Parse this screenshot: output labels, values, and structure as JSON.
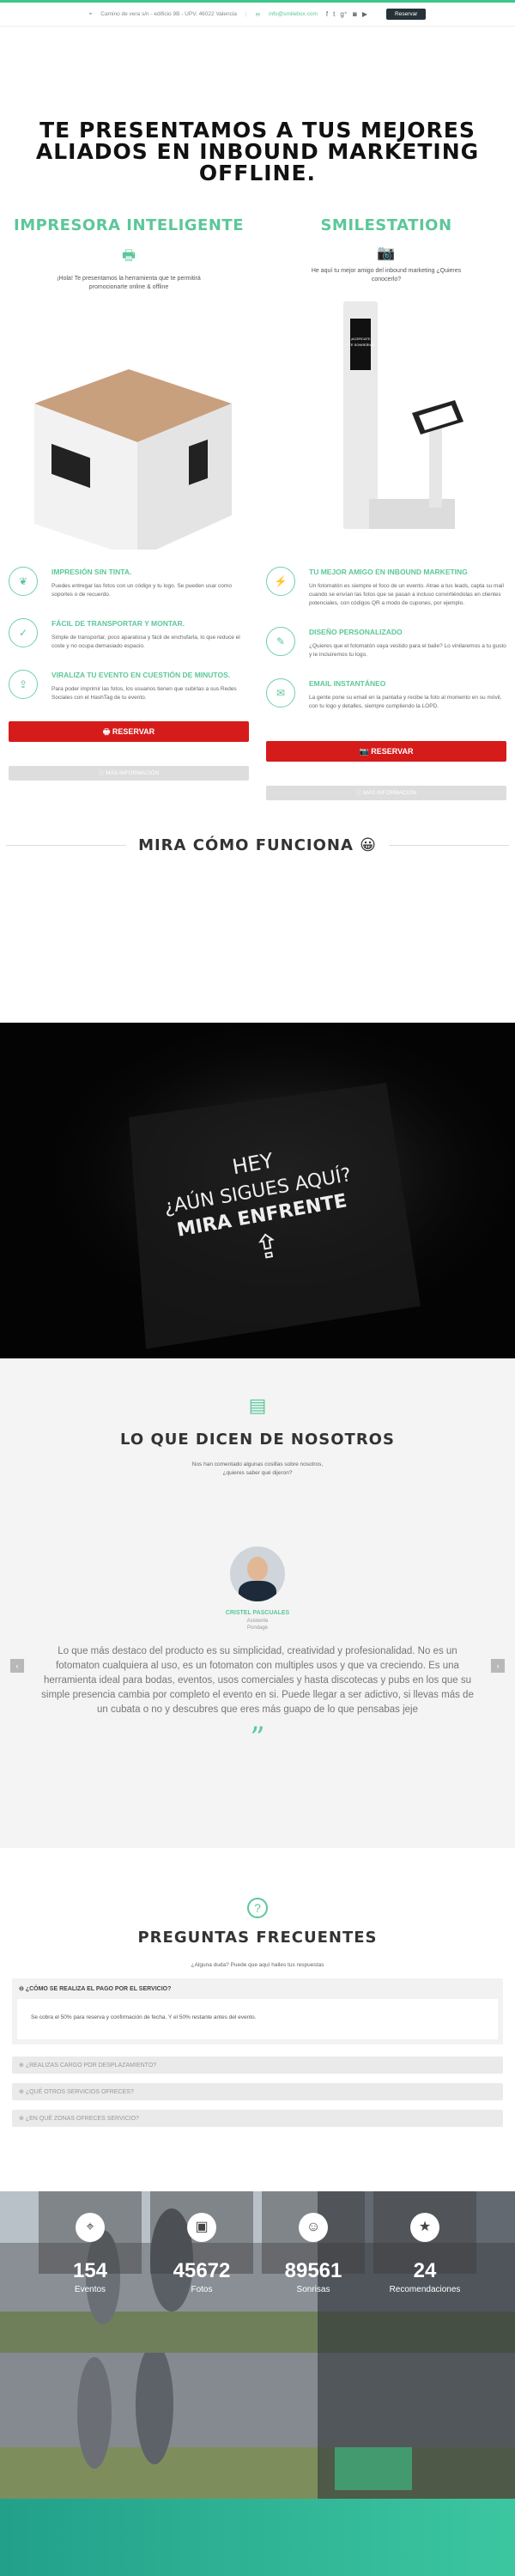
{
  "topbar": {
    "address": "Camino de vera s/n - edificio 9B - UPV, 46022 Valencia",
    "email": "info@smilebox.com",
    "reserve_label": "Reservar"
  },
  "hero": {
    "title": "TE PRESENTAMOS A TUS MEJORES ALIADOS EN INBOUND MARKETING OFFLINE."
  },
  "products": [
    {
      "title": "IMPRESORA INTELIGENTE",
      "lead": "¡Hola! Te presentamos la herramienta que te permitirá promocionarte online & offline",
      "features": [
        {
          "title": "IMPRESIÓN SIN TINTA.",
          "text": "Puedes entregar las fotos con un código y tu logo. Se pueden usar como soportes o de recuerdo."
        },
        {
          "title": "FÁCIL DE TRANSPORTAR Y MONTAR.",
          "text": "Simple de transportar, poco aparatosa y fácil de enchufarla, lo que reduce el coste y no ocupa demasiado espacio."
        },
        {
          "title": "VIRALIZA TU EVENTO EN CUESTIÓN DE MINUTOS.",
          "text": "Para poder imprimir las fotos, los usuarios tienen que subirlas a sus Redes Sociales con el HashTag de tu evento."
        }
      ],
      "reserve": "RESERVAR",
      "more": "MÁS INFORMACIÓN"
    },
    {
      "title": "SMILESTATION",
      "lead": "He aquí tu mejor amigo del inbound marketing ¿Quieres conocerlo?",
      "screen_text": "¡ACERCATE Y TE SONREÍRÁS!",
      "features": [
        {
          "title": "TU MEJOR AMIGO EN INBOUND MARKETING",
          "text": "Un fotomatón es siempre el foco de un evento. Atrae a tus leads, capta su mail cuando se envían las fotos que se pasan a incluso convirtiéndolas en clientes potenciales, con códigos QR a modo de cupones, por ejemplo."
        },
        {
          "title": "DISEÑO PERSONALIZADO",
          "text": "¿Quieres que el fotomatón vaya vestido para el baile? Lo vinilaremos a tu gusto y le incluiremos tu logo."
        },
        {
          "title": "EMAIL INSTANTÁNEO",
          "text": "La gente pone su email en la pantalla y recibe la foto al momento en su móvil, con tu logo y detalles, siempre cumpliendo la LOPD."
        }
      ],
      "reserve": "RESERVAR",
      "more": "MÁS INFORMACIÓN"
    }
  ],
  "how": {
    "title": "MIRA CÓMO FUNCIONA 😀"
  },
  "video": {
    "line1": "HEY",
    "line2": "¿AÚN SIGUES AQUÍ?",
    "line3": "MIRA ENFRENTE"
  },
  "testimonials": {
    "title": "LO QUE DICEN DE NOSOTROS",
    "subtitle": "Nos han comentado algunas cosillas sobre nosotros, ¿quieres saber qué dijeron?",
    "name": "CRISTEL PASCUALES",
    "role1": "Asistente",
    "role2": "Pondage",
    "quote": "Lo que más destaco del producto es su simplicidad, creatividad y profesionalidad. No es un fotomaton cualquiera al uso, es un fotomaton con multiples usos y que va creciendo. Es una herramienta ideal para bodas, eventos, usos comerciales y hasta discotecas y pubs en los que su simple presencia cambia por completo el evento en si. Puede llegar a ser adictivo, si llevas más de un cubata o no y descubres que eres más guapo de lo que pensabas jeje"
  },
  "faq": {
    "title": "PREGUNTAS FRECUENTES",
    "subtitle": "¿Alguna duda? Puede que aquí halles tus respuestas",
    "items": [
      {
        "q": "¿CÓMO SE REALIZA EL PAGO POR EL SERVICIO?",
        "a": "Se cobra el 50% para reserva y confirmación de fecha. Y el 50% restante antes del evento."
      },
      {
        "q": "¿REALIZAS CARGO POR DESPLAZAMIENTO?"
      },
      {
        "q": "¿QUÉ OTROS SERVICIOS OFRECES?"
      },
      {
        "q": "¿EN QUÉ ZONAS OFRECES SERVICIO?"
      }
    ]
  },
  "stats": [
    {
      "value": "154",
      "label": "Eventos",
      "icon": "map-pin-icon"
    },
    {
      "value": "45672",
      "label": "Fotos",
      "icon": "photo-icon"
    },
    {
      "value": "89561",
      "label": "Sonrisas",
      "icon": "smile-icon"
    },
    {
      "value": "24",
      "label": "Recomendaciones",
      "icon": "star-icon"
    }
  ]
}
